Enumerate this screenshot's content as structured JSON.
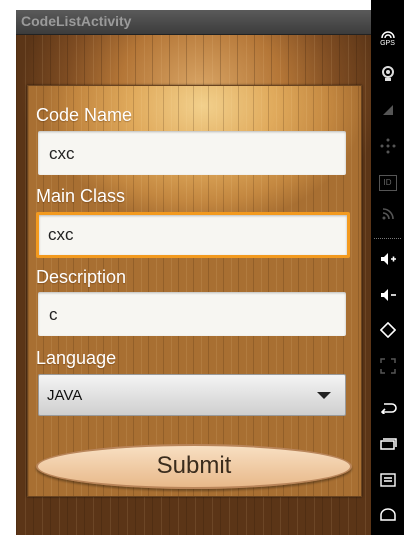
{
  "app": {
    "title": "CodeListActivity"
  },
  "form": {
    "code_name": {
      "label": "Code Name",
      "value": "cxc"
    },
    "main_class": {
      "label": "Main Class",
      "value": "cxc"
    },
    "description": {
      "label": "Description",
      "value": "c"
    },
    "language": {
      "label": "Language",
      "selected": "JAVA"
    },
    "submit_label": "Submit"
  },
  "sidebar": {
    "gps_label": "GPS",
    "id_label": "ID"
  },
  "colors": {
    "focus_border": "#f39a1f",
    "title_text": "#9a9a9a"
  }
}
